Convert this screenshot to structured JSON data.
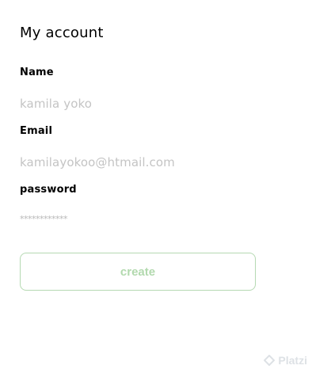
{
  "page": {
    "title": "My account"
  },
  "form": {
    "name_label": "Name",
    "name_value": "kamila yoko",
    "email_label": "Email",
    "email_value": "kamilayokoo@htmail.com",
    "password_label": "password",
    "password_value": "************",
    "create_label": "create"
  },
  "watermark": {
    "text": "Platzi"
  },
  "colors": {
    "accent": "#b5d9b2",
    "muted_text": "#c4c4c4"
  }
}
